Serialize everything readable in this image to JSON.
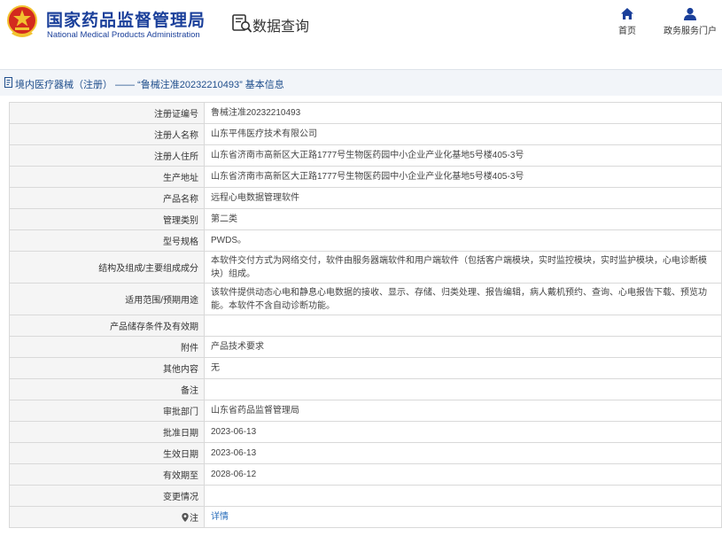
{
  "header": {
    "org_name_cn": "国家药品监督管理局",
    "org_name_en": "National Medical Products Administration",
    "page_title": "数据查询",
    "nav": [
      {
        "label": "首页",
        "icon": "home-icon"
      },
      {
        "label": "政务服务门户",
        "icon": "user-icon"
      }
    ]
  },
  "breadcrumb": {
    "text": "境内医疗器械（注册） —— “鲁械注准20232210493” 基本信息"
  },
  "record": {
    "rows": [
      {
        "label": "注册证编号",
        "value": "鲁械注准20232210493"
      },
      {
        "label": "注册人名称",
        "value": "山东平伟医疗技术有限公司"
      },
      {
        "label": "注册人住所",
        "value": "山东省济南市高新区大正路1777号生物医药园中小企业产业化基地5号楼405-3号"
      },
      {
        "label": "生产地址",
        "value": "山东省济南市高新区大正路1777号生物医药园中小企业产业化基地5号楼405-3号"
      },
      {
        "label": "产品名称",
        "value": "远程心电数据管理软件"
      },
      {
        "label": "管理类别",
        "value": "第二类"
      },
      {
        "label": "型号规格",
        "value": "PWDS。"
      },
      {
        "label": "结构及组成/主要组成成分",
        "value": "本软件交付方式为网络交付，软件由服务器端软件和用户端软件（包括客户端模块，实时监控模块，实时监护模块，心电诊断模块）组成。"
      },
      {
        "label": "适用范围/预期用途",
        "value": "该软件提供动态心电和静息心电数据的接收、显示、存储、归类处理、报告编辑，病人戴机预约、查询、心电报告下载、预览功能。本软件不含自动诊断功能。"
      },
      {
        "label": "产品储存条件及有效期",
        "value": ""
      },
      {
        "label": "附件",
        "value": "产品技术要求"
      },
      {
        "label": "其他内容",
        "value": "无"
      },
      {
        "label": "备注",
        "value": ""
      },
      {
        "label": "审批部门",
        "value": "山东省药品监督管理局"
      },
      {
        "label": "批准日期",
        "value": "2023-06-13"
      },
      {
        "label": "生效日期",
        "value": "2023-06-13"
      },
      {
        "label": "有效期至",
        "value": "2028-06-12"
      },
      {
        "label": "变更情况",
        "value": ""
      }
    ],
    "note": {
      "label": "注",
      "value": "详情"
    }
  },
  "colors": {
    "brand_blue": "#1a3f9a",
    "emblem_red": "#d32a1e",
    "emblem_gold": "#f2c230",
    "link_blue": "#2a6ebb",
    "breadcrumb_bg": "#f2f5f9"
  }
}
